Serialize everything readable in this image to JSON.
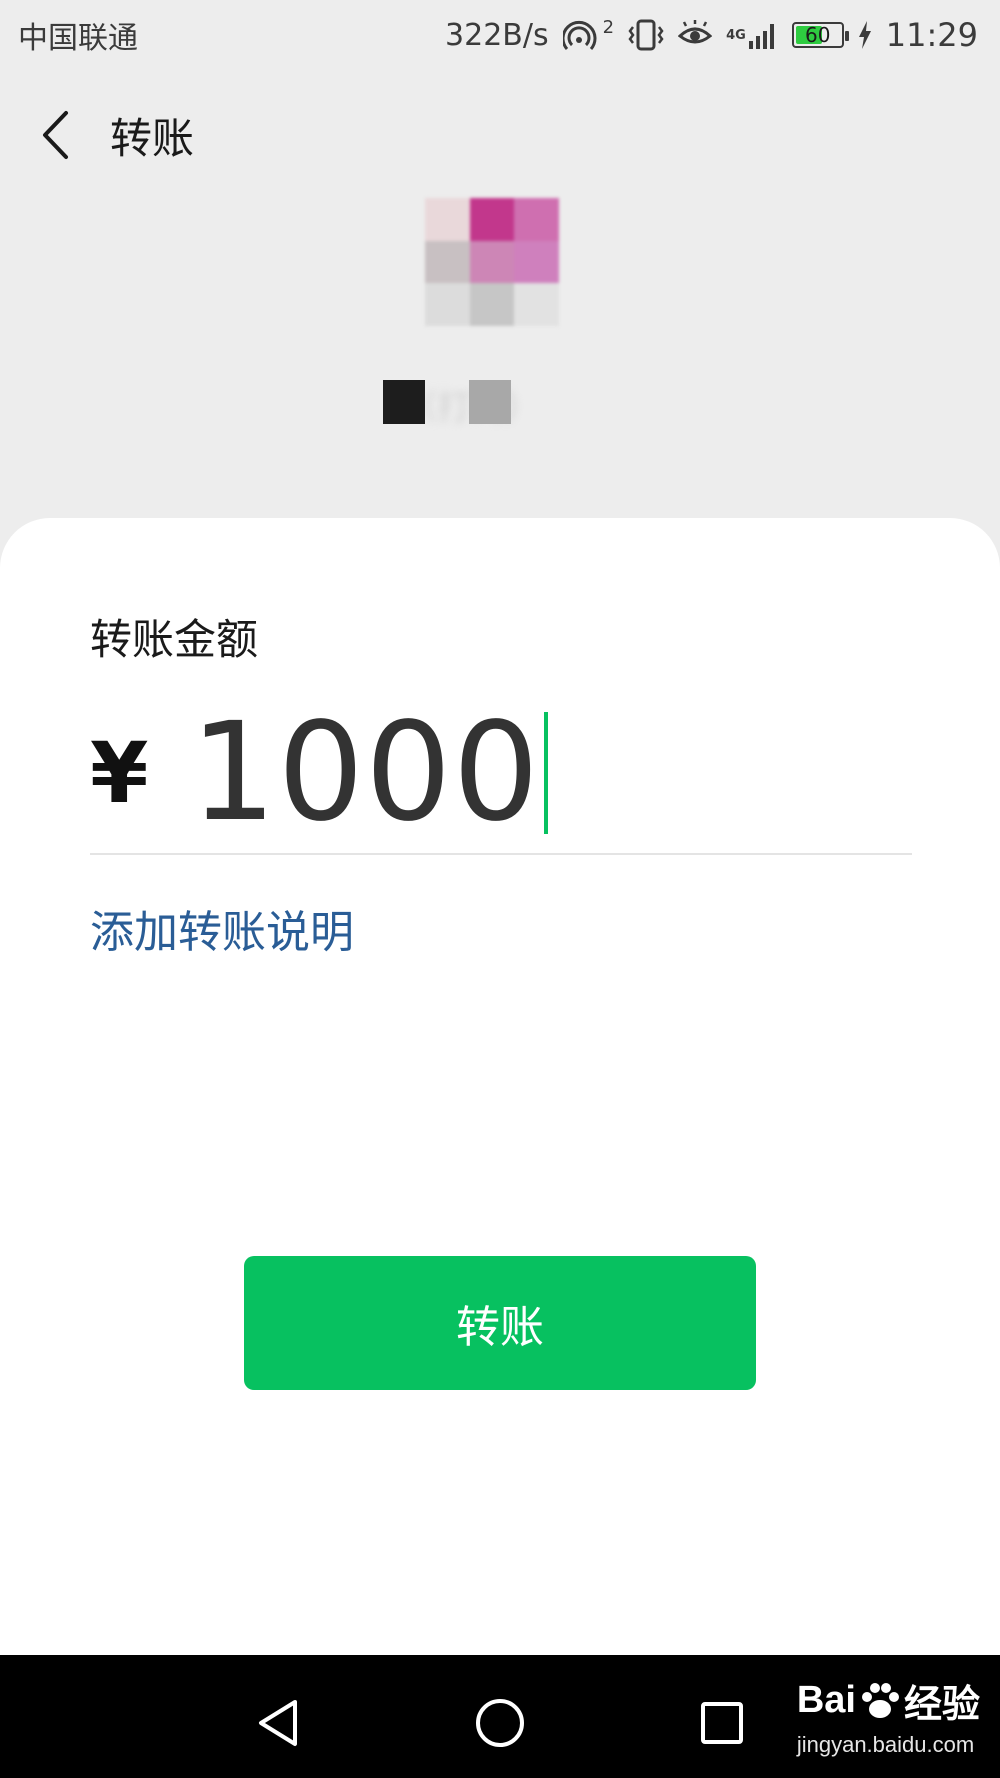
{
  "status_bar": {
    "carrier": "中国联通",
    "net_speed": "322B/s",
    "hotspot_badge": "2",
    "network_type": "4G",
    "battery_level": "60",
    "battery_fraction": 0.6,
    "time": "11:29"
  },
  "header": {
    "back_icon": "chevron-left-icon",
    "title": "转账"
  },
  "recipient": {
    "avatar": "pixelated-avatar",
    "name": "（打码）"
  },
  "transfer": {
    "amount_label": "转账金额",
    "currency_symbol": "¥",
    "amount": "1000",
    "add_note_link": "添加转账说明",
    "submit_label": "转账"
  },
  "colors": {
    "accent_green": "#07c160",
    "link_blue": "#2a5d96",
    "page_bg": "#ededed"
  },
  "nav_bar": {
    "back_icon": "triangle-back-icon",
    "home_icon": "circle-home-icon",
    "recents_icon": "square-recents-icon"
  },
  "watermark": {
    "brand": "Bai经验",
    "brand_prefix": "Bai",
    "brand_suffix": "经验",
    "url": "jingyan.baidu.com"
  }
}
